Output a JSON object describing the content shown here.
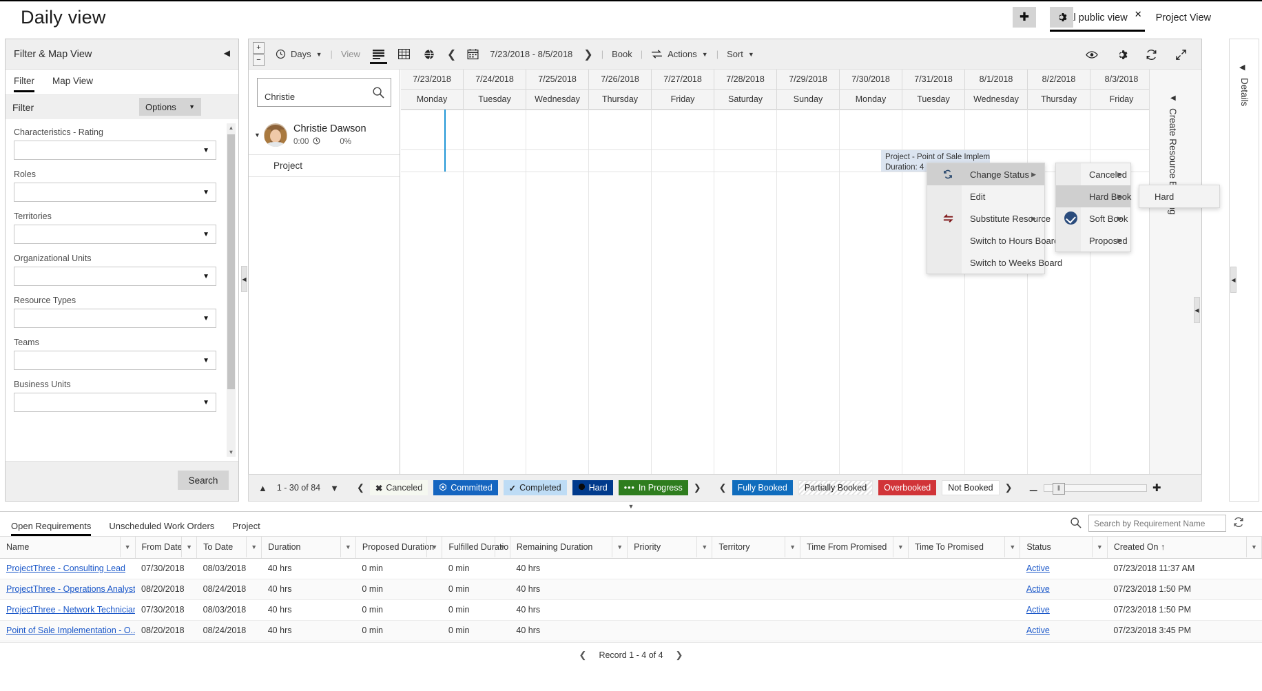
{
  "header": {
    "page_title": "Daily view",
    "tabs": [
      {
        "label": "Initial public view",
        "active": true,
        "closable": true
      },
      {
        "label": "Project View",
        "active": false,
        "closable": false
      }
    ],
    "add_button_icon": "plus-icon",
    "settings_button_icon": "gear-icon"
  },
  "filter_panel": {
    "title": "Filter & Map View",
    "collapse_icon": "chevron-left-icon",
    "tabs": [
      {
        "label": "Filter",
        "active": true
      },
      {
        "label": "Map View",
        "active": false
      }
    ],
    "section_label": "Filter",
    "options_label": "Options",
    "fields": [
      {
        "label": "Characteristics - Rating",
        "value": ""
      },
      {
        "label": "Roles",
        "value": ""
      },
      {
        "label": "Territories",
        "value": ""
      },
      {
        "label": "Organizational Units",
        "value": ""
      },
      {
        "label": "Resource Types",
        "value": ""
      },
      {
        "label": "Teams",
        "value": ""
      },
      {
        "label": "Business Units",
        "value": ""
      }
    ],
    "search_label": "Search"
  },
  "scheduler": {
    "toolbar": {
      "zoom_in_icon": "plus-box-icon",
      "zoom_out_icon": "minus-box-icon",
      "timescale_icon": "clock-icon",
      "timescale_label": "Days",
      "view_label": "View",
      "view_list_icon": "list-view-icon",
      "view_grid_icon": "grid-view-icon",
      "view_map_icon": "globe-view-icon",
      "prev_icon": "chevron-left-icon",
      "calendar_icon": "calendar-icon",
      "date_range": "7/23/2018 - 8/5/2018",
      "next_icon": "chevron-right-icon",
      "book_label": "Book",
      "actions_icon": "swap-icon",
      "actions_label": "Actions",
      "sort_label": "Sort",
      "eye_icon": "eye-icon",
      "gear_icon": "gear-icon",
      "refresh_icon": "refresh-icon",
      "expand_icon": "expand-icon"
    },
    "resource_search": {
      "value": "Christie",
      "placeholder": "",
      "icon": "search-icon"
    },
    "resource": {
      "expander_icon": "chevron-down-icon",
      "name": "Christie Dawson",
      "hours": "0:00",
      "hours_icon": "clock-icon",
      "utilization": "0%",
      "sub_row_label": "Project",
      "avatar": "avatar"
    },
    "columns": [
      {
        "date": "7/23/2018",
        "day": "Monday"
      },
      {
        "date": "7/24/2018",
        "day": "Tuesday"
      },
      {
        "date": "7/25/2018",
        "day": "Wednesday"
      },
      {
        "date": "7/26/2018",
        "day": "Thursday"
      },
      {
        "date": "7/27/2018",
        "day": "Friday"
      },
      {
        "date": "7/28/2018",
        "day": "Saturday"
      },
      {
        "date": "7/29/2018",
        "day": "Sunday"
      },
      {
        "date": "7/30/2018",
        "day": "Monday"
      },
      {
        "date": "7/31/2018",
        "day": "Tuesday"
      },
      {
        "date": "8/1/2018",
        "day": "Wednesday"
      },
      {
        "date": "8/2/2018",
        "day": "Thursday"
      },
      {
        "date": "8/3/2018",
        "day": "Friday"
      }
    ],
    "booking_chip": {
      "line1": "Project - Point of Sale Implemen",
      "line2": "Duration: 4"
    },
    "rail": {
      "caret_icon": "chevron-left-icon",
      "label": "Create Resource Booking"
    },
    "details_rail": {
      "caret_icon": "chevron-left-icon",
      "label": "Details"
    }
  },
  "legend": {
    "pager_up_icon": "chevron-up-icon",
    "pager_text": "1 - 30 of 84",
    "pager_down_icon": "chevron-down-icon",
    "prev_icon": "chevron-left-icon",
    "next_icon": "chevron-right-icon",
    "status_chips": [
      {
        "label": "Canceled",
        "icon": "x-icon",
        "color": "#f5f8f0",
        "text_color": "#333333"
      },
      {
        "label": "Committed",
        "icon": "committed-icon",
        "color": "#1565c0",
        "text_color": "#ffffff"
      },
      {
        "label": "Completed",
        "icon": "check-icon",
        "color": "#bedcf5",
        "text_color": "#222222"
      },
      {
        "label": "Hard",
        "icon": "circle-icon",
        "color": "#003a8c",
        "text_color": "#ffffff"
      },
      {
        "label": "In Progress",
        "icon": "dots-icon",
        "color": "#2e7d1e",
        "text_color": "#ffffff"
      }
    ],
    "booking_chips": [
      {
        "label": "Fully Booked",
        "color": "#0f6cbd",
        "text_color": "#ffffff"
      },
      {
        "label": "Partially Booked",
        "color": "#ffffff",
        "text_color": "#222222"
      },
      {
        "label": "Overbooked",
        "color": "#d13438",
        "text_color": "#ffffff"
      },
      {
        "label": "Not Booked",
        "color": "#ffffff",
        "text_color": "#222222"
      }
    ],
    "zoom_out_icon": "minus-icon",
    "zoom_in_icon": "plus-icon"
  },
  "context_menu": {
    "items": [
      {
        "label": "Change Status",
        "icon": "change-status-icon",
        "submenu": true,
        "highlighted": true
      },
      {
        "label": "Edit",
        "icon": "",
        "submenu": false,
        "highlighted": false
      },
      {
        "label": "Substitute Resource",
        "icon": "substitute-icon",
        "submenu": true,
        "highlighted": false
      },
      {
        "label": "Switch to Hours Board",
        "icon": "",
        "submenu": false,
        "highlighted": false
      },
      {
        "label": "Switch to Weeks Board",
        "icon": "",
        "submenu": false,
        "highlighted": false
      }
    ],
    "status_submenu": [
      {
        "label": "Canceled",
        "submenu": true,
        "checked": false,
        "highlighted": false
      },
      {
        "label": "Hard Book",
        "submenu": true,
        "checked": false,
        "highlighted": true
      },
      {
        "label": "Soft Book",
        "submenu": true,
        "checked": true,
        "highlighted": false
      },
      {
        "label": "Proposed",
        "submenu": true,
        "checked": false,
        "highlighted": false
      }
    ],
    "hard_book_submenu": [
      {
        "label": "Hard"
      }
    ]
  },
  "bottom_pane": {
    "tabs": [
      {
        "label": "Open Requirements",
        "active": true
      },
      {
        "label": "Unscheduled Work Orders",
        "active": false
      },
      {
        "label": "Project",
        "active": false
      }
    ],
    "search": {
      "placeholder": "Search by Requirement Name",
      "value": "",
      "icon": "search-icon"
    },
    "refresh_icon": "refresh-icon",
    "columns": [
      "Name",
      "From Date",
      "To Date",
      "Duration",
      "Proposed Duration",
      "Fulfilled Duration",
      "Remaining Duration",
      "Priority",
      "Territory",
      "Time From Promised",
      "Time To Promised",
      "Status",
      "Created On ↑"
    ],
    "rows": [
      {
        "name": "ProjectThree - Consulting Lead",
        "from_date": "07/30/2018",
        "to_date": "08/03/2018",
        "duration": "40 hrs",
        "proposed_duration": "0 min",
        "fulfilled_duration": "0 min",
        "remaining_duration": "40 hrs",
        "priority": "",
        "territory": "",
        "time_from_promised": "",
        "time_to_promised": "",
        "status": "Active",
        "created_on": "07/23/2018 11:37 AM"
      },
      {
        "name": "ProjectThree - Operations Analyst",
        "from_date": "08/20/2018",
        "to_date": "08/24/2018",
        "duration": "40 hrs",
        "proposed_duration": "0 min",
        "fulfilled_duration": "0 min",
        "remaining_duration": "40 hrs",
        "priority": "",
        "territory": "",
        "time_from_promised": "",
        "time_to_promised": "",
        "status": "Active",
        "created_on": "07/23/2018 1:50 PM"
      },
      {
        "name": "ProjectThree - Network Technician",
        "from_date": "07/30/2018",
        "to_date": "08/03/2018",
        "duration": "40 hrs",
        "proposed_duration": "0 min",
        "fulfilled_duration": "0 min",
        "remaining_duration": "40 hrs",
        "priority": "",
        "territory": "",
        "time_from_promised": "",
        "time_to_promised": "",
        "status": "Active",
        "created_on": "07/23/2018 1:50 PM"
      },
      {
        "name": "Point of Sale Implementation - O...",
        "from_date": "08/20/2018",
        "to_date": "08/24/2018",
        "duration": "40 hrs",
        "proposed_duration": "0 min",
        "fulfilled_duration": "0 min",
        "remaining_duration": "40 hrs",
        "priority": "",
        "territory": "",
        "time_from_promised": "",
        "time_to_promised": "",
        "status": "Active",
        "created_on": "07/23/2018 3:45 PM"
      }
    ],
    "record_nav": {
      "prev_icon": "chevron-left-icon",
      "text": "Record 1 - 4 of 4",
      "next_icon": "chevron-right-icon"
    }
  }
}
